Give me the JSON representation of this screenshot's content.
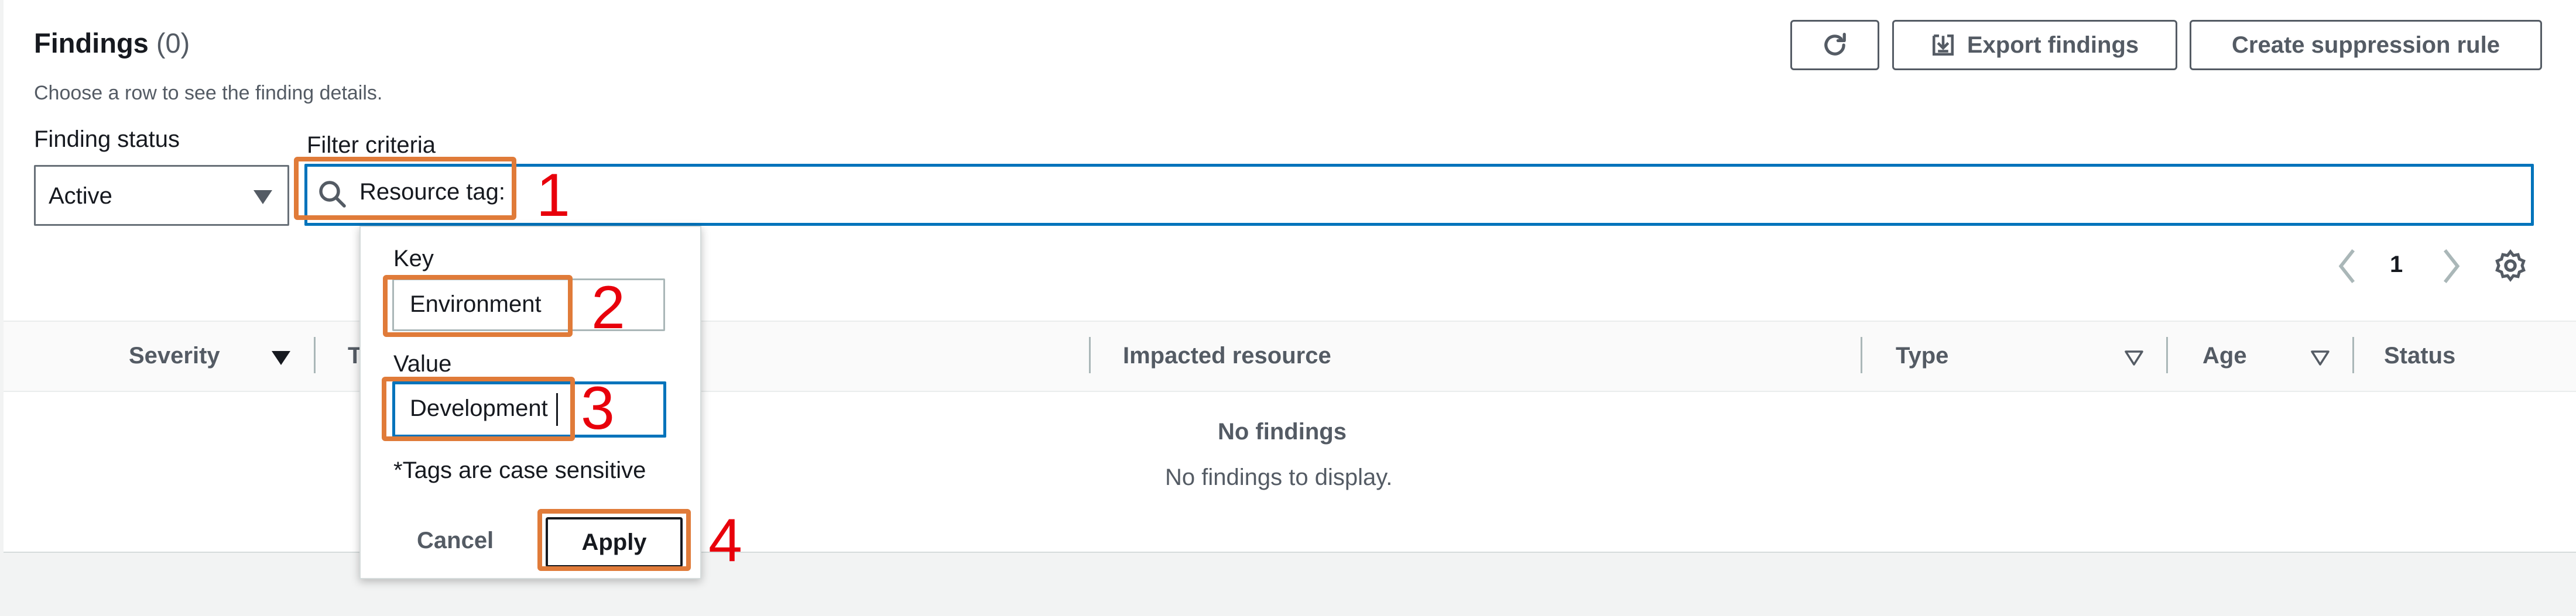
{
  "header": {
    "title": "Findings",
    "count": "(0)",
    "subtitle": "Choose a row to see the finding details."
  },
  "toolbar": {
    "refresh_icon": "refresh-icon",
    "export_label": "Export findings",
    "export_icon": "download-icon",
    "suppress_label": "Create suppression rule"
  },
  "filters": {
    "status_label": "Finding status",
    "status_value": "Active",
    "criteria_label": "Filter criteria",
    "token": "Resource tag:"
  },
  "popover": {
    "key_label": "Key",
    "key_value": "Environment",
    "value_label": "Value",
    "value_value": "Development",
    "note": "*Tags are case sensitive",
    "cancel_label": "Cancel",
    "apply_label": "Apply"
  },
  "pagination": {
    "page": "1"
  },
  "table": {
    "columns": {
      "severity": "Severity",
      "title_partial": "T",
      "resource": "Impacted resource",
      "type": "Type",
      "age": "Age",
      "status": "Status"
    },
    "empty_title": "No findings",
    "empty_subtitle": "No findings to display."
  },
  "annotations": {
    "n1": "1",
    "n2": "2",
    "n3": "3",
    "n4": "4",
    "color": "#e07b39",
    "number_color": "#e8000b"
  },
  "colors": {
    "focus_blue": "#0073bb",
    "text_secondary": "#545b64"
  }
}
